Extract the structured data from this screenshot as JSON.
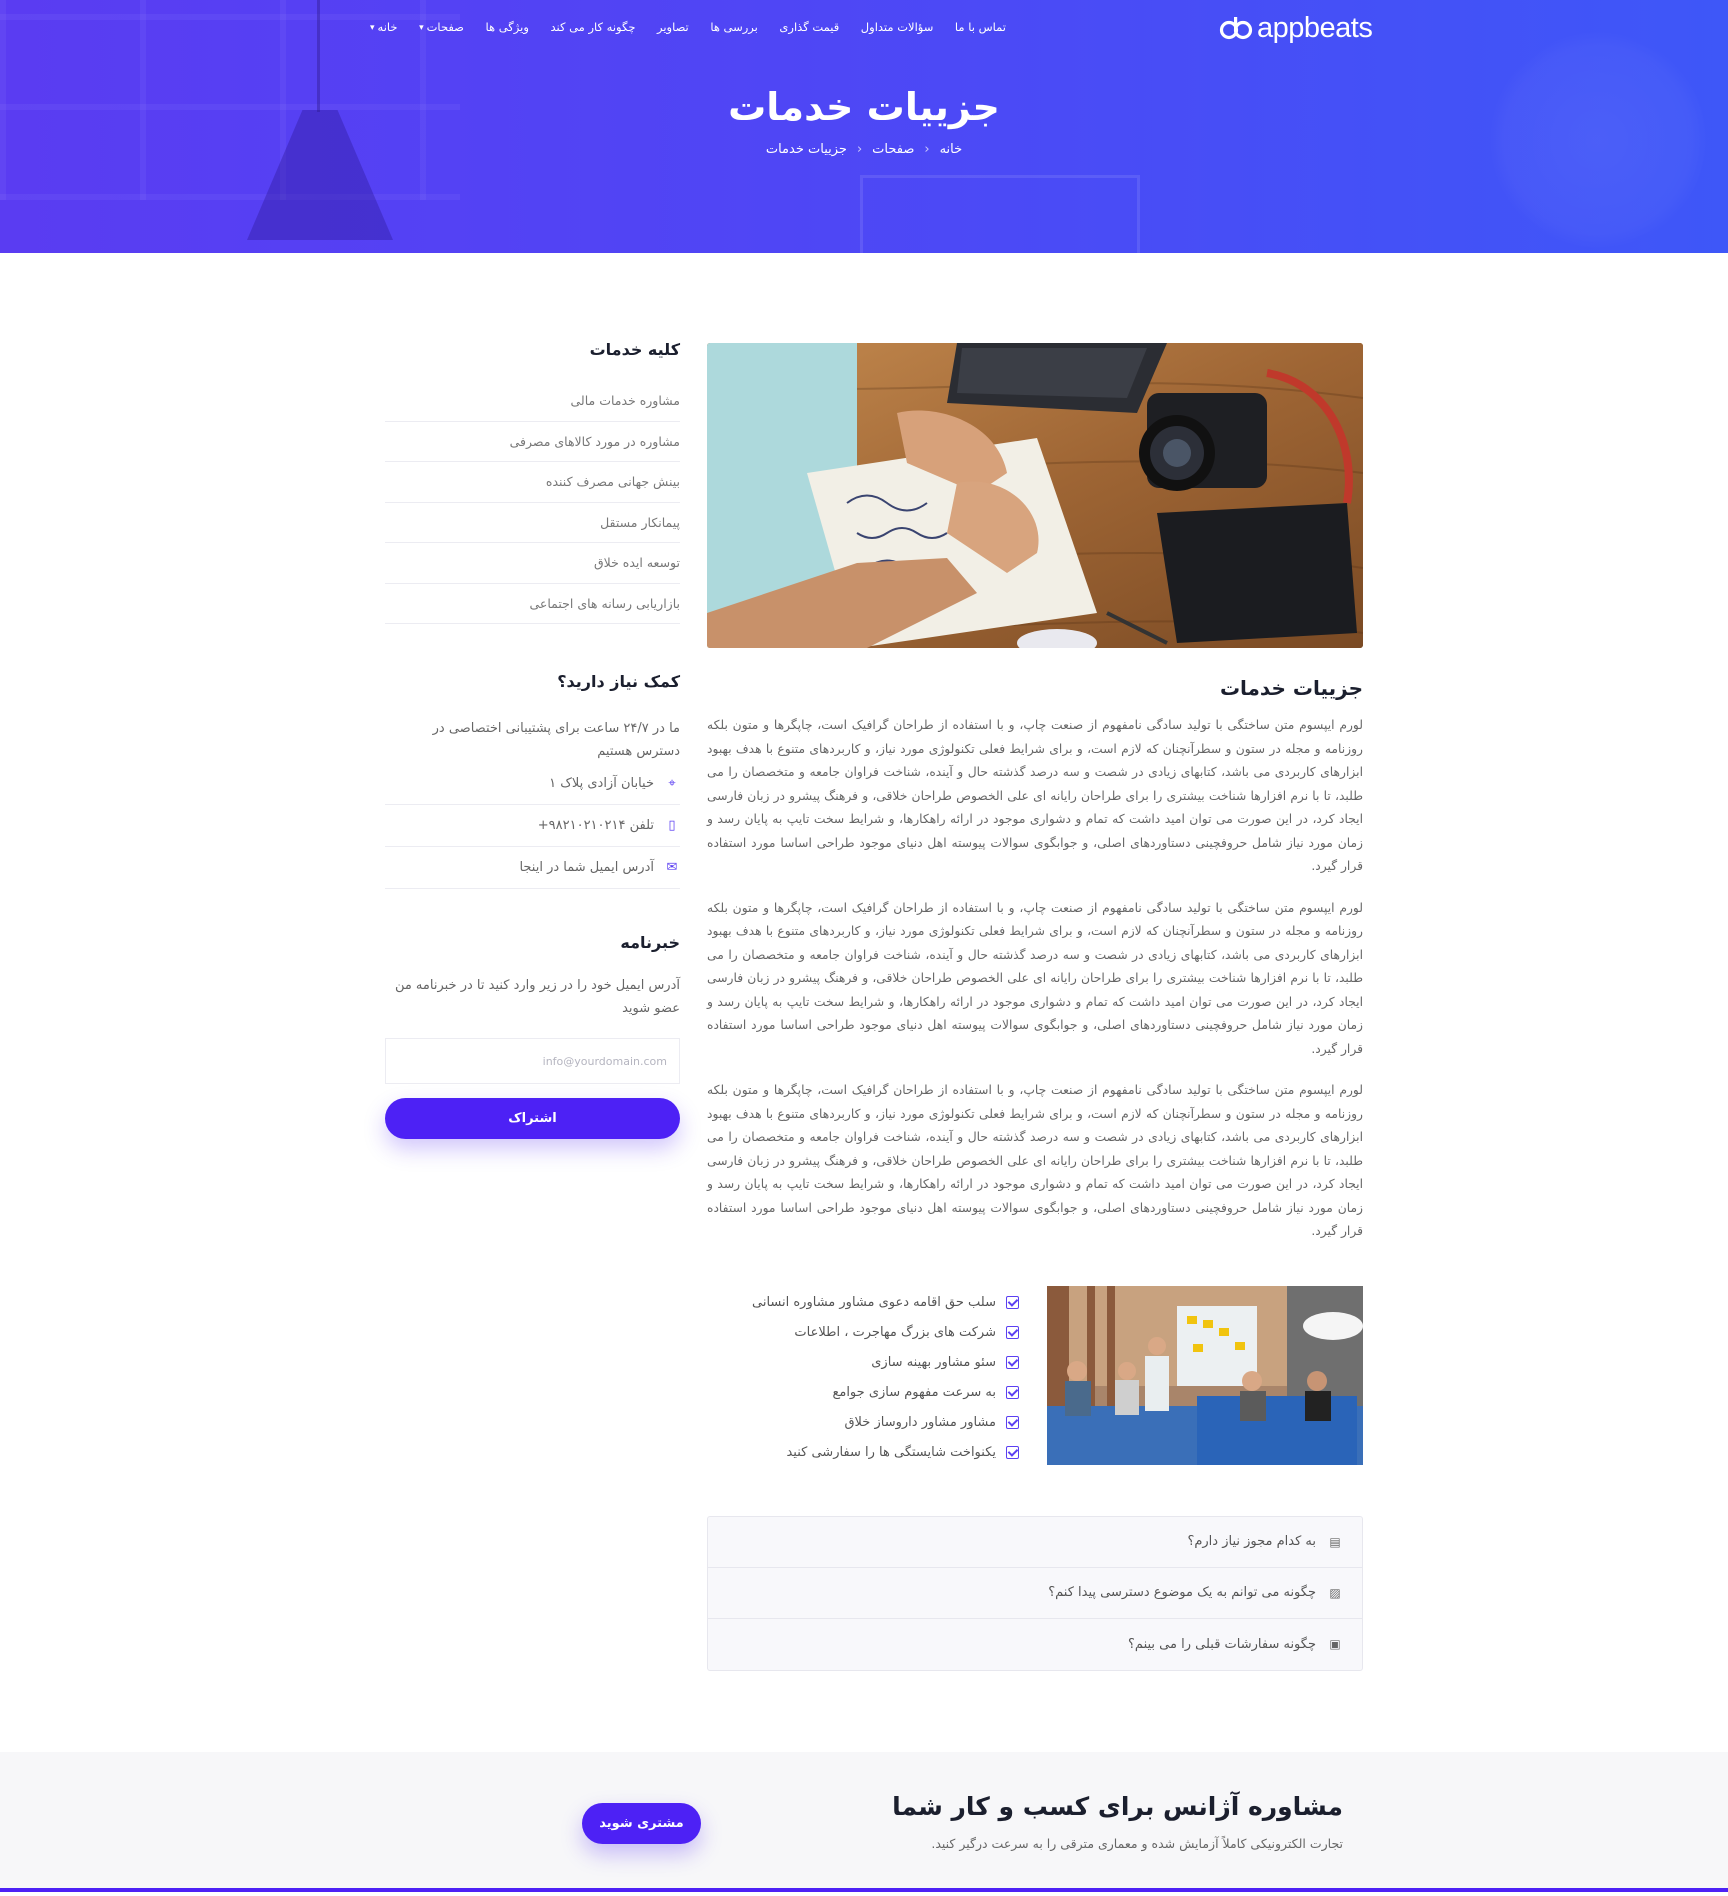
{
  "brand": {
    "name": "appbeats"
  },
  "nav": {
    "items": [
      {
        "label": "خانه",
        "dropdown": true
      },
      {
        "label": "صفحات",
        "dropdown": true
      },
      {
        "label": "ویژگی ها",
        "dropdown": false
      },
      {
        "label": "چگونه کار می کند",
        "dropdown": false
      },
      {
        "label": "تصاویر",
        "dropdown": false
      },
      {
        "label": "بررسی ها",
        "dropdown": false
      },
      {
        "label": "قیمت گذاری",
        "dropdown": false
      },
      {
        "label": "سؤالات متداول",
        "dropdown": false
      },
      {
        "label": "تماس با ما",
        "dropdown": false
      }
    ],
    "caret": "▾"
  },
  "hero": {
    "title": "جزییات خدمات",
    "breadcrumb": [
      "خانه",
      "صفحات",
      "جزییات خدمات"
    ],
    "separator": "‹"
  },
  "sidebar": {
    "services_title": "کلیه خدمات",
    "services": [
      "مشاوره خدمات مالی",
      "مشاوره در مورد کالاهای مصرفی",
      "بینش جهانی مصرف کننده",
      "پیمانکار مستقل",
      "توسعه ایده خلاق",
      "بازاریابی رسانه های اجتماعی"
    ],
    "help_title": "کمک نیاز دارید؟",
    "help_desc": "ما در ۲۴/۷ ساعت برای پشتیبانی اختصاصی در دسترس هستیم",
    "contacts": [
      {
        "icon": "location-pin-icon",
        "glyph": "⌖",
        "text": "خیابان آزادی پلاک ۱"
      },
      {
        "icon": "phone-icon",
        "glyph": "▯",
        "text": "تلفن ۹۸۲۱۰۲۱۰۲۱۴+"
      },
      {
        "icon": "envelope-icon",
        "glyph": "✉",
        "text": "آدرس ایمیل شما در اینجا"
      }
    ],
    "newsletter_title": "خبرنامه",
    "newsletter_desc": "آدرس ایمیل خود را در زیر وارد کنید تا در خبرنامه من عضو شوید",
    "email_placeholder": "info@yourdomain.com",
    "subscribe_label": "اشتراک"
  },
  "main": {
    "title": "جزییات خدمات",
    "paragraphs": [
      "لورم ایپسوم متن ساختگی با تولید سادگی نامفهوم از صنعت چاپ، و با استفاده از طراحان گرافیک است، چاپگرها و متون بلکه روزنامه و مجله در ستون و سطرآنچنان که لازم است، و برای شرایط فعلی تکنولوژی مورد نیاز، و کاربردهای متنوع با هدف بهبود ابزارهای کاربردی می باشد، کتابهای زیادی در شصت و سه درصد گذشته حال و آینده، شناخت فراوان جامعه و متخصصان را می طلبد، تا با نرم افزارها شناخت بیشتری را برای طراحان رایانه ای علی الخصوص طراحان خلاقی، و فرهنگ پیشرو در زبان فارسی ایجاد کرد، در این صورت می توان امید داشت که تمام و دشواری موجود در ارائه راهکارها، و شرایط سخت تایپ به پایان رسد و زمان مورد نیاز شامل حروفچینی دستاوردهای اصلی، و جوابگوی سوالات پیوسته اهل دنیای موجود طراحی اساسا مورد استفاده قرار گیرد.",
      "لورم ایپسوم متن ساختگی با تولید سادگی نامفهوم از صنعت چاپ، و با استفاده از طراحان گرافیک است، چاپگرها و متون بلکه روزنامه و مجله در ستون و سطرآنچنان که لازم است، و برای شرایط فعلی تکنولوژی مورد نیاز، و کاربردهای متنوع با هدف بهبود ابزارهای کاربردی می باشد، کتابهای زیادی در شصت و سه درصد گذشته حال و آینده، شناخت فراوان جامعه و متخصصان را می طلبد، تا با نرم افزارها شناخت بیشتری را برای طراحان رایانه ای علی الخصوص طراحان خلاقی، و فرهنگ پیشرو در زبان فارسی ایجاد کرد، در این صورت می توان امید داشت که تمام و دشواری موجود در ارائه راهکارها، و شرایط سخت تایپ به پایان رسد و زمان مورد نیاز شامل حروفچینی دستاوردهای اصلی، و جوابگوی سوالات پیوسته اهل دنیای موجود طراحی اساسا مورد استفاده قرار گیرد.",
      "لورم ایپسوم متن ساختگی با تولید سادگی نامفهوم از صنعت چاپ، و با استفاده از طراحان گرافیک است، چاپگرها و متون بلکه روزنامه و مجله در ستون و سطرآنچنان که لازم است، و برای شرایط فعلی تکنولوژی مورد نیاز، و کاربردهای متنوع با هدف بهبود ابزارهای کاربردی می باشد، کتابهای زیادی در شصت و سه درصد گذشته حال و آینده، شناخت فراوان جامعه و متخصصان را می طلبد، تا با نرم افزارها شناخت بیشتری را برای طراحان رایانه ای علی الخصوص طراحان خلاقی، و فرهنگ پیشرو در زبان فارسی ایجاد کرد، در این صورت می توان امید داشت که تمام و دشواری موجود در ارائه راهکارها، و شرایط سخت تایپ به پایان رسد و زمان مورد نیاز شامل حروفچینی دستاوردهای اصلی، و جوابگوی سوالات پیوسته اهل دنیای موجود طراحی اساسا مورد استفاده قرار گیرد."
    ],
    "checklist": [
      "سلب حق اقامه دعوی مشاور مشاوره انسانی",
      "شرکت های بزرگ مهاجرت ، اطلاعات",
      "سئو مشاور بهینه سازی",
      "به سرعت مفهوم سازی جوامع",
      "مشاور مشاور داروساز خلاق",
      "یکنواخت شایستگی ها را سفارشی کنید"
    ],
    "faq": [
      {
        "icon": "document-icon",
        "glyph": "▤",
        "text": "به کدام مجوز نیاز دارم؟"
      },
      {
        "icon": "image-icon",
        "glyph": "▨",
        "text": "چگونه می توانم به یک موضوع دسترسی پیدا کنم؟"
      },
      {
        "icon": "wallet-icon",
        "glyph": "▣",
        "text": "چگونه سفارشات قبلی را می بینم؟"
      }
    ]
  },
  "cta": {
    "title": "مشاوره آژانس برای کسب و کار شما",
    "subtitle": "تجارت الکترونیکی کاملاً آزمایش شده و معماری مترقی را به سرعت درگیر کنید.",
    "button_label": "مشتری شوید"
  },
  "colors": {
    "accent": "#4d21f5",
    "hero_gradient_start": "#5a3cf2",
    "hero_gradient_end": "#3e57f8",
    "heading": "#1b1f2e",
    "body_text": "#666666"
  }
}
